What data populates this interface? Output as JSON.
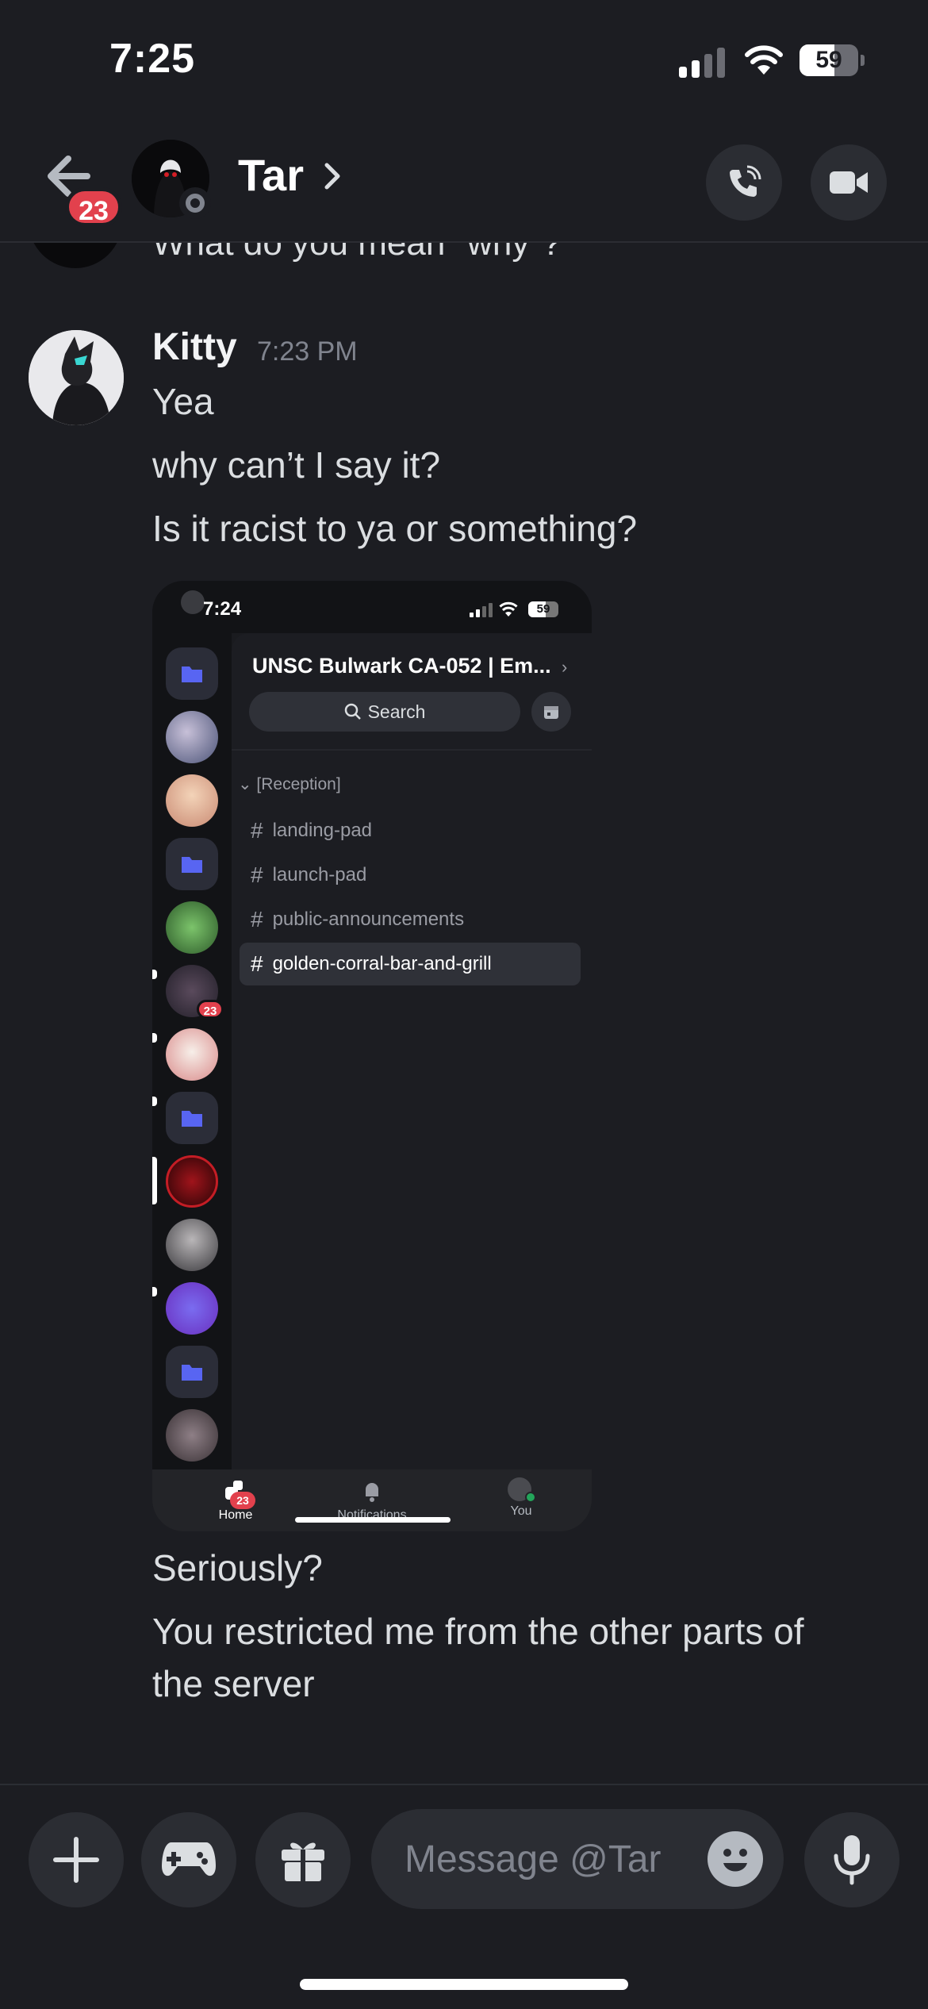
{
  "status_bar": {
    "time": "7:25",
    "battery": "59",
    "battery_level": 0.59
  },
  "header": {
    "back_badge": "23",
    "contact_name": "Tar"
  },
  "chat": {
    "previous_message_partial": "What do you mean \"why\"?",
    "message": {
      "author": "Kitty",
      "timestamp": "7:23 PM",
      "lines": [
        "Yea",
        "why can’t I say it?",
        "Is it racist to ya or something?"
      ],
      "after_lines": [
        "Seriously?",
        "You restricted me from the other parts of",
        "the server"
      ]
    },
    "attachment": {
      "status_time": "7:24",
      "battery": "59",
      "server_name": "UNSC Bulwark CA-052 | Em...",
      "search_label": "Search",
      "category": "Reception",
      "channels": [
        "landing-pad",
        "launch-pad",
        "public-announcements",
        "golden-corral-bar-and-grill"
      ],
      "active_channel_index": 3,
      "rail_badge": "23",
      "tabs": {
        "home": "Home",
        "notifications": "Notifications",
        "you": "You",
        "home_badge": "23"
      }
    }
  },
  "composer": {
    "placeholder": "Message @Tar"
  },
  "colors": {
    "background": "#1c1d22",
    "badge_red": "#e2414d",
    "folder_blurple": "#5865f2"
  }
}
